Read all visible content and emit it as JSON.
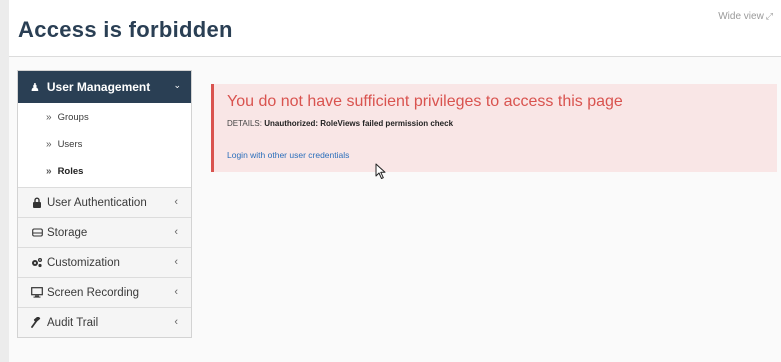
{
  "header": {
    "title": "Access is forbidden",
    "wide_view_label": "Wide view",
    "wide_view_icon": "expand-icon"
  },
  "sidebar": {
    "active_group": {
      "label": "User Management",
      "icon": "user-icon",
      "expanded": true,
      "items": [
        {
          "label": "Groups",
          "current": false
        },
        {
          "label": "Users",
          "current": false
        },
        {
          "label": "Roles",
          "current": true
        }
      ]
    },
    "items": [
      {
        "label": "User Authentication",
        "icon": "lock-icon"
      },
      {
        "label": "Storage",
        "icon": "hdd-icon"
      },
      {
        "label": "Customization",
        "icon": "cogs-icon"
      },
      {
        "label": "Screen Recording",
        "icon": "monitor-icon"
      },
      {
        "label": "Audit Trail",
        "icon": "gavel-icon"
      }
    ]
  },
  "alert": {
    "title": "You do not have sufficient privileges to access this page",
    "details_label": "DETAILS:",
    "details_value": "Unauthorized: RoleViews failed permission check",
    "link_text": "Login with other user credentials"
  },
  "colors": {
    "nav_dark": "#2a3f54",
    "alert_bg": "#f9e6e6",
    "alert_red": "#d9534f",
    "link_blue": "#2a6ebb"
  }
}
